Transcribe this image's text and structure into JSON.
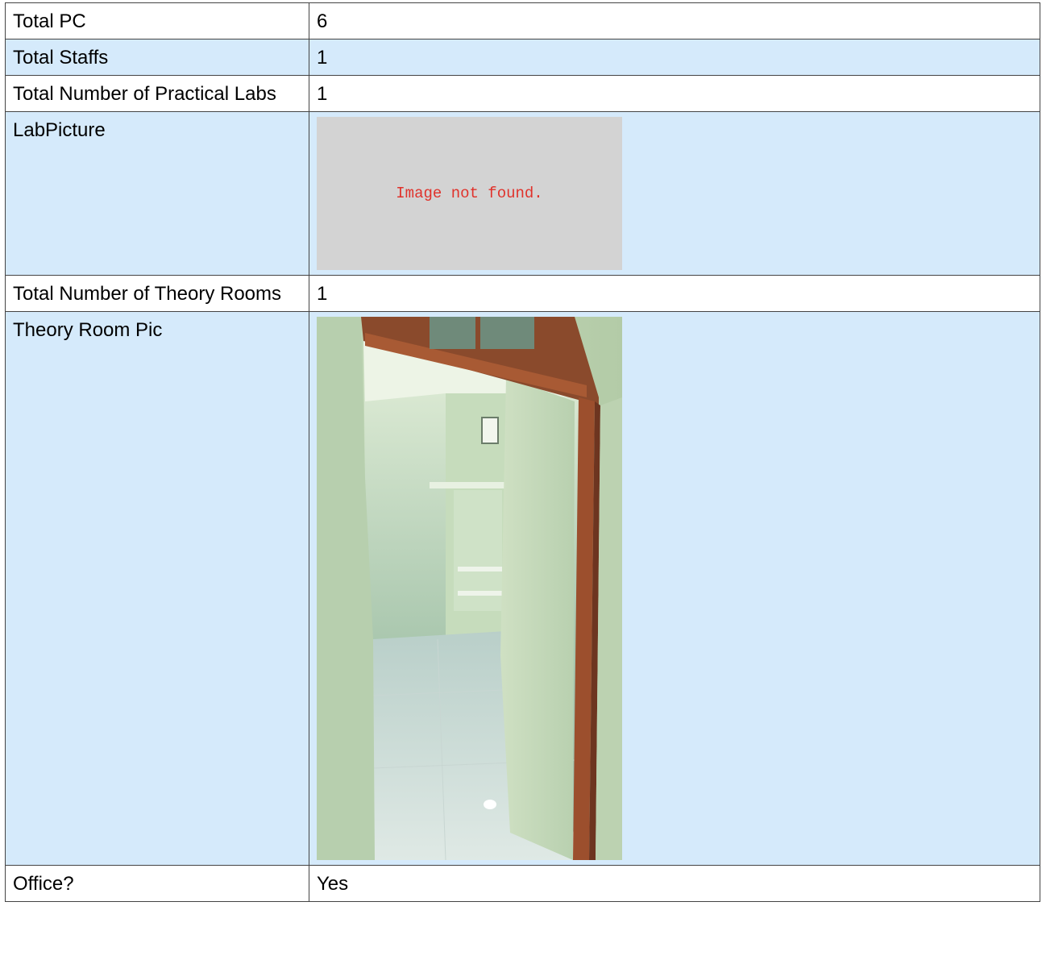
{
  "rows": [
    {
      "label": "Total PC",
      "value": "6"
    },
    {
      "label": "Total Staffs",
      "value": "1"
    },
    {
      "label": "Total Number of Practical Labs",
      "value": "1"
    },
    {
      "label": "LabPicture",
      "image_error": "Image not found."
    },
    {
      "label": "Total Number of Theory Rooms",
      "value": "1"
    },
    {
      "label": "Theory Room Pic",
      "photo": "theory-room-photo"
    },
    {
      "label": "Office?",
      "value": "Yes"
    }
  ],
  "colors": {
    "row_alt_background": "#d5eafb",
    "row_background": "#ffffff",
    "border": "#444444",
    "placeholder_background": "#d3d3d3",
    "error_text": "#e0322b"
  }
}
